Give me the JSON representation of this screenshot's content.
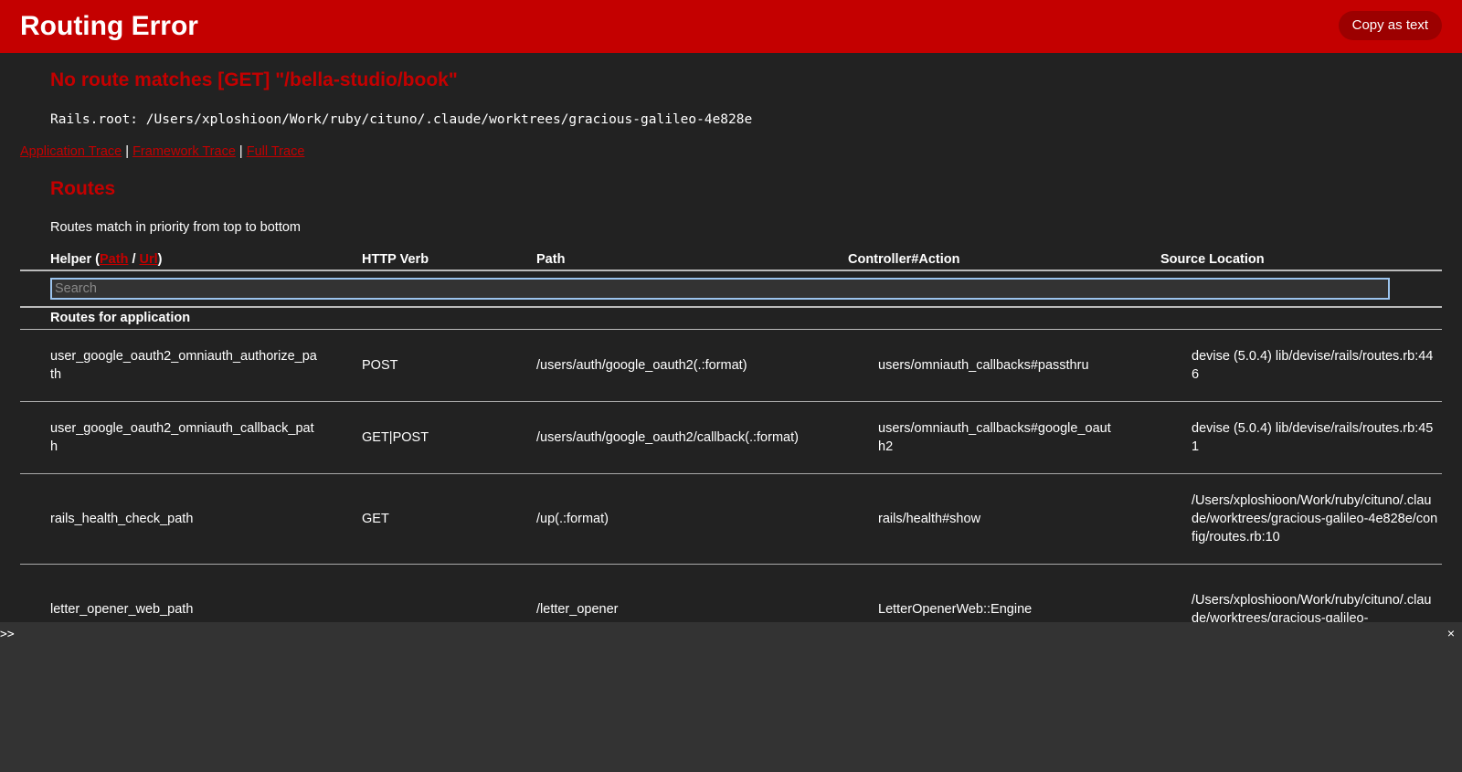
{
  "header": {
    "title": "Routing Error",
    "copy_label": "Copy as text"
  },
  "error": {
    "message": "No route matches [GET] \"/bella-studio/book\"",
    "rails_root": "Rails.root: /Users/xploshioon/Work/ruby/cituno/.claude/worktrees/gracious-galileo-4e828e"
  },
  "trace": {
    "application": "Application Trace",
    "framework": "Framework Trace",
    "full": "Full Trace",
    "separator": "|"
  },
  "routes": {
    "title": "Routes",
    "description": "Routes match in priority from top to bottom",
    "columns": {
      "helper_prefix": "Helper (",
      "helper_path": "Path",
      "helper_sep": " / ",
      "helper_url": "Url",
      "helper_suffix": ")",
      "verb": "HTTP Verb",
      "path": "Path",
      "controller": "Controller#Action",
      "source": "Source Location"
    },
    "search_placeholder": "Search",
    "group_label": "Routes for application",
    "rows": [
      {
        "helper": "user_google_oauth2_omniauth_authorize_path",
        "verb": "POST",
        "path": "/users/auth/google_oauth2(.:format)",
        "controller": "users/omniauth_callbacks#passthru",
        "source": "devise (5.0.4) lib/devise/rails/routes.rb:446"
      },
      {
        "helper": "user_google_oauth2_omniauth_callback_path",
        "verb": "GET|POST",
        "path": "/users/auth/google_oauth2/callback(.:format)",
        "controller": "users/omniauth_callbacks#google_oauth2",
        "source": "devise (5.0.4) lib/devise/rails/routes.rb:451"
      },
      {
        "helper": "rails_health_check_path",
        "verb": "GET",
        "path": "/up(.:format)",
        "controller": "rails/health#show",
        "source": "/Users/xploshioon/Work/ruby/cituno/.claude/worktrees/gracious-galileo-4e828e/config/routes.rb:10"
      },
      {
        "helper": "letter_opener_web_path",
        "verb": "",
        "path": "/letter_opener",
        "controller": "LetterOpenerWeb::Engine",
        "source": "/Users/xploshioon/Work/ruby/cituno/.claude/worktrees/gracious-galileo-"
      }
    ]
  },
  "console": {
    "prompt": ">>",
    "close_label": "×"
  }
}
